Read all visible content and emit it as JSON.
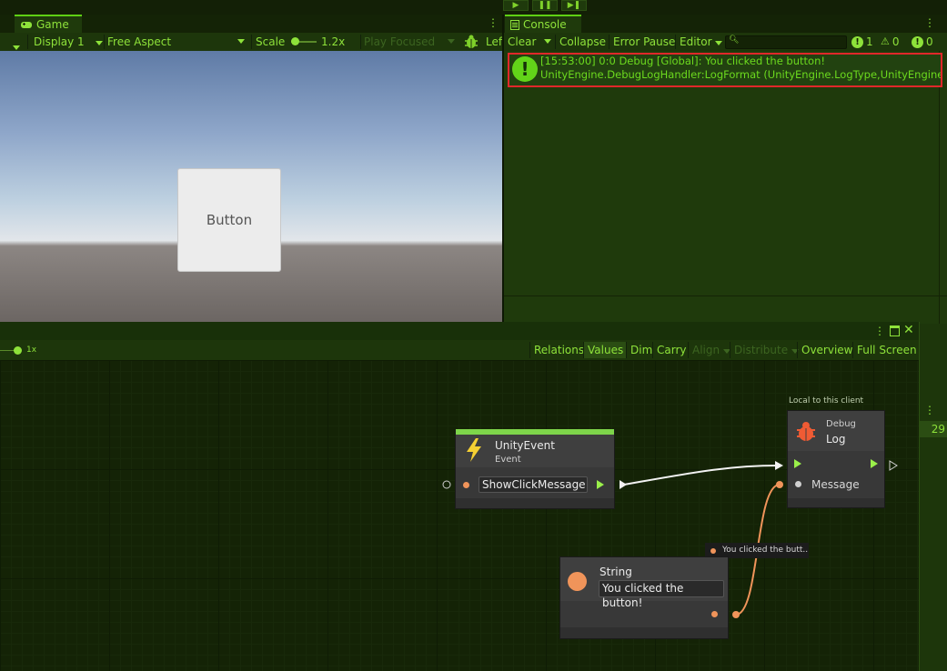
{
  "play_controls": [
    "▶",
    "❚❚",
    "▶❚"
  ],
  "game": {
    "tab_label": "Game",
    "display": "Display 1",
    "aspect": "Free Aspect",
    "scale_label": "Scale",
    "scale_value": "1.2x",
    "play_focused": "Play Focused",
    "truncated": "Lef",
    "button_label": "Button"
  },
  "console": {
    "tab_label": "Console",
    "clear": "Clear",
    "collapse": "Collapse",
    "error_pause": "Error Pause",
    "editor": "Editor",
    "counts": {
      "messages": "1",
      "warnings": "0",
      "errors": "0"
    },
    "entry_line1": "[15:53:00] 0:0 Debug [Global]: You clicked the button!",
    "entry_line2": "UnityEngine.DebugLogHandler:LogFormat (UnityEngine.LogType,UnityEngine."
  },
  "graph": {
    "zoom_label": "1x",
    "toolbar": [
      "Relations",
      "Values",
      "Dim",
      "Carry",
      "Align",
      "Distribute",
      "Overview",
      "Full Screen"
    ],
    "side_number": "29",
    "unity_event": {
      "title": "UnityEvent",
      "subtitle": "Event",
      "value": "ShowClickMessage"
    },
    "debug_log": {
      "caption": "Local to this client",
      "title": "Debug",
      "subtitle": "Log",
      "port_label": "Message"
    },
    "string_node": {
      "title": "String",
      "value": "You clicked the button!"
    },
    "value_tooltip": "You clicked the butt..."
  }
}
